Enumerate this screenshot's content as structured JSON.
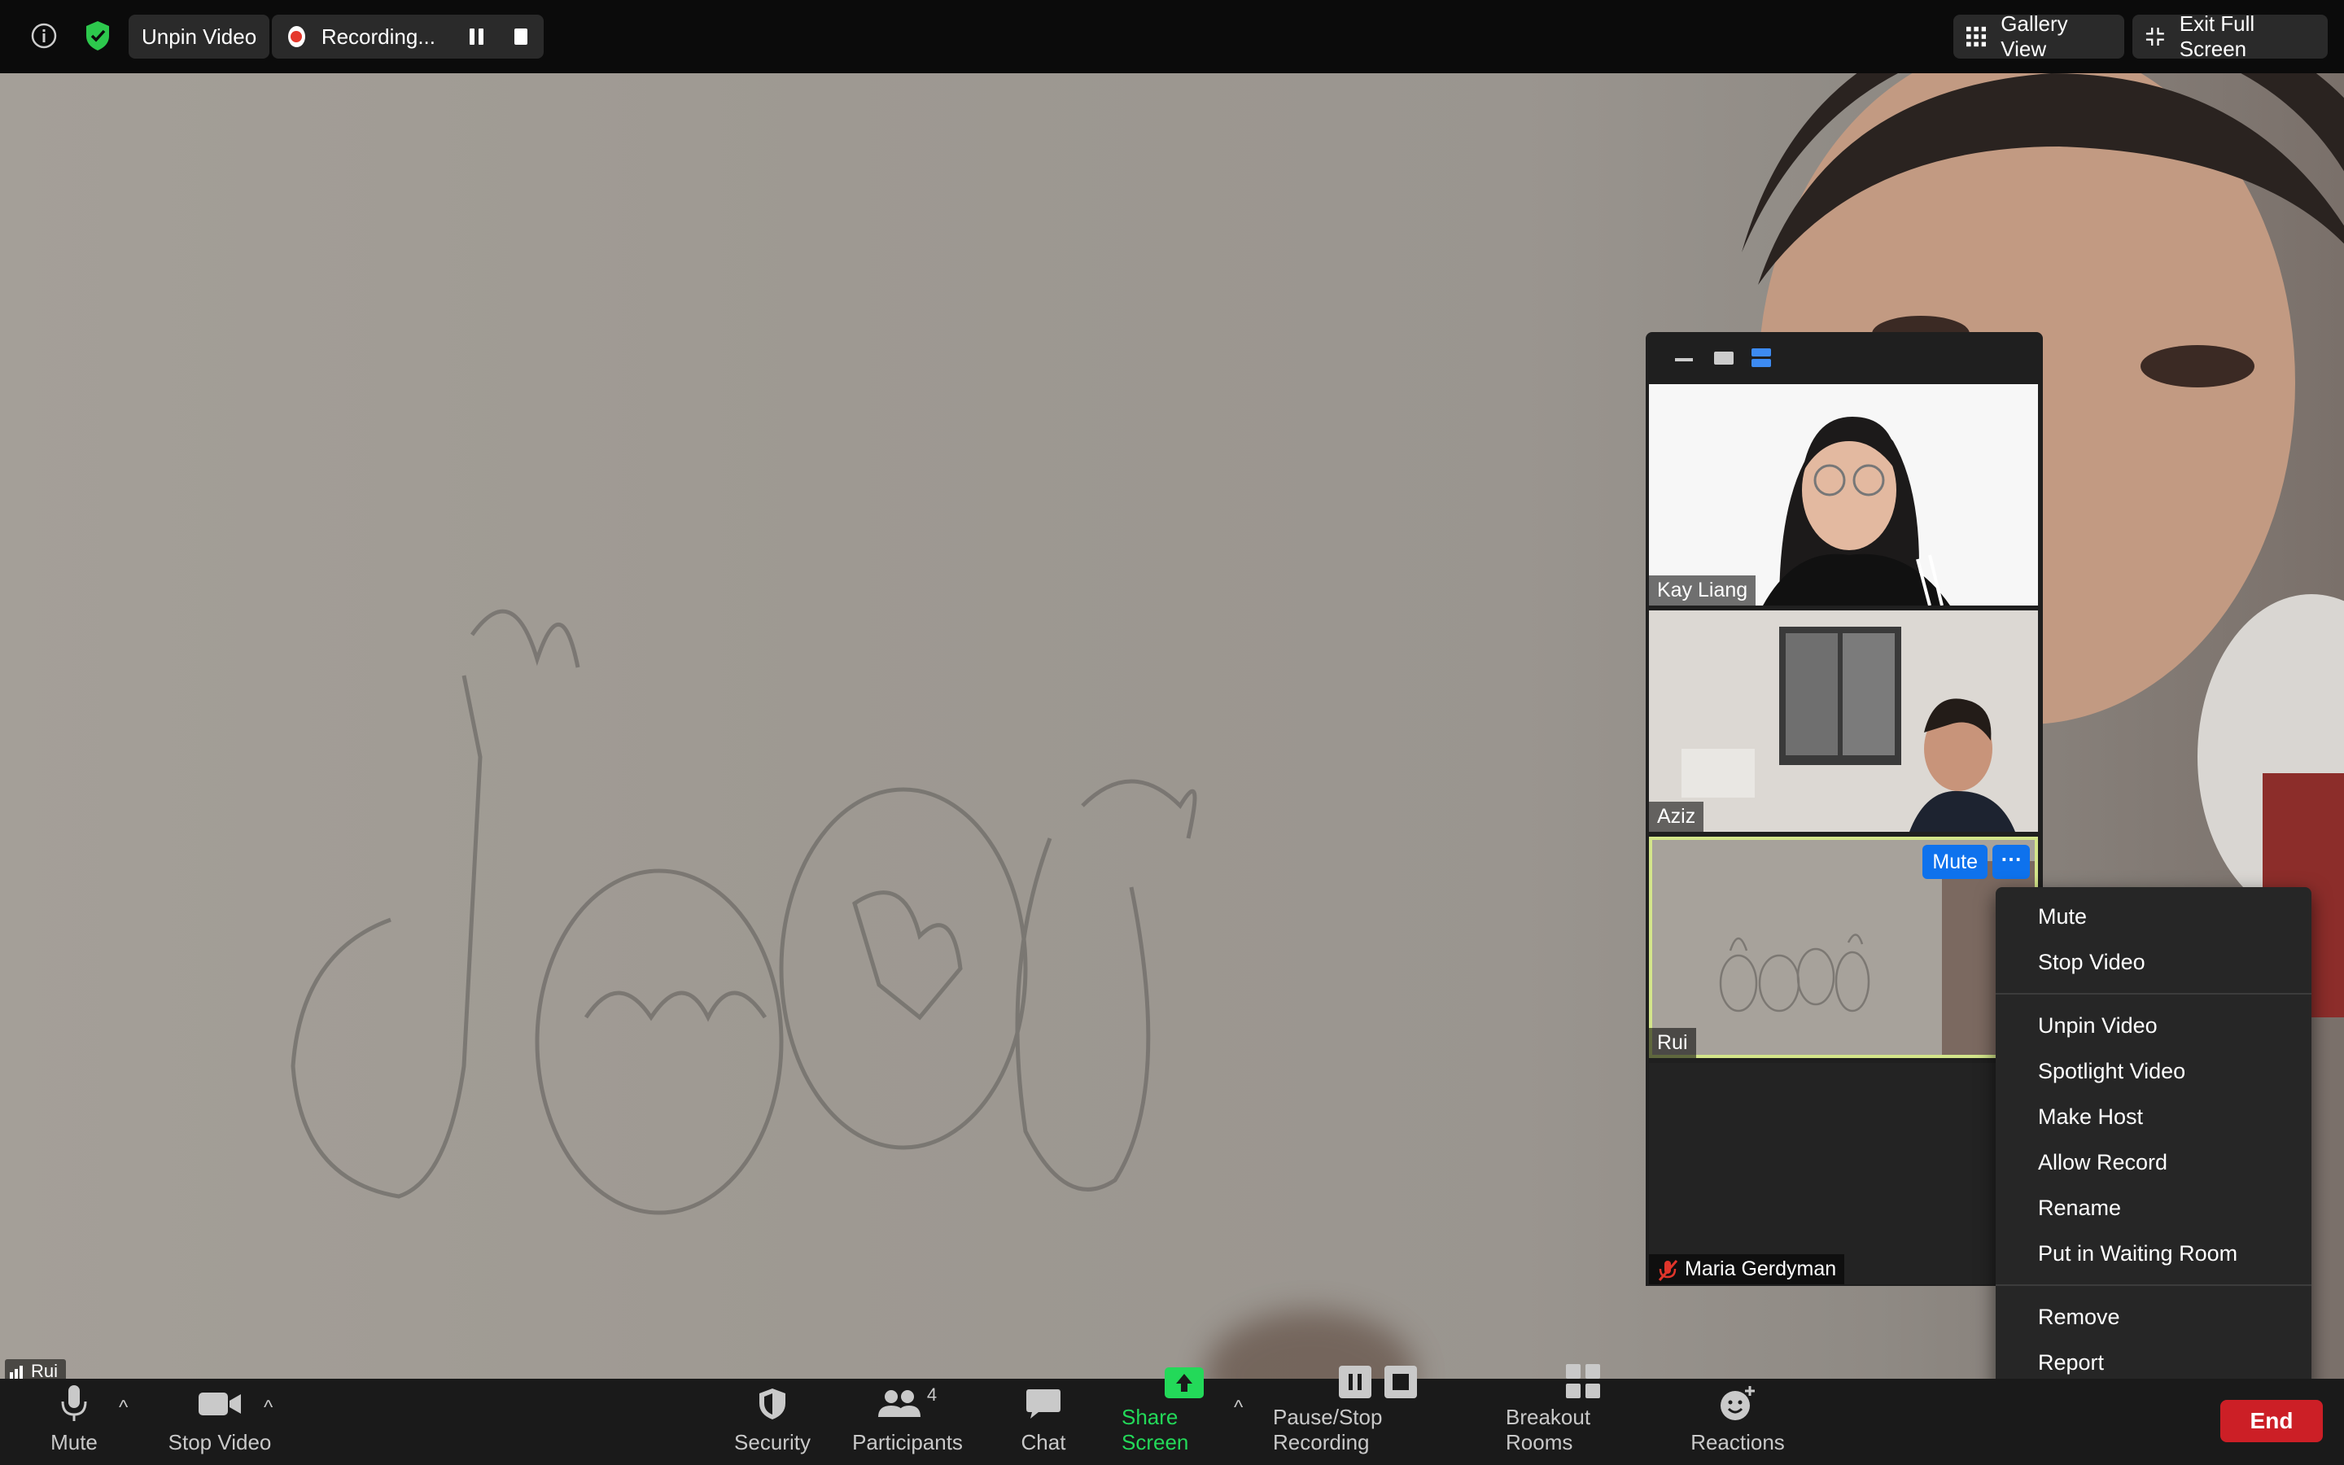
{
  "top_bar": {
    "unpin_label": "Unpin Video",
    "recording_label": "Recording...",
    "gallery_view_label": "Gallery View",
    "exit_full_screen_label": "Exit Full Screen"
  },
  "main_video": {
    "speaker_name": "Rui"
  },
  "panel": {
    "participants": [
      {
        "name": "Kay Liang"
      },
      {
        "name": "Aziz"
      },
      {
        "name": "Rui"
      },
      {
        "name": "Maria Gerdyman",
        "muted": true
      }
    ],
    "mute_button_label": "Mute",
    "more_button_label": "⋯"
  },
  "context_menu": {
    "items": [
      "Mute",
      "Stop Video",
      "Unpin Video",
      "Spotlight Video",
      "Make Host",
      "Allow Record",
      "Rename",
      "Put in Waiting Room",
      "Remove",
      "Report"
    ]
  },
  "toolbar": {
    "mute_label": "Mute",
    "stop_video_label": "Stop Video",
    "security_label": "Security",
    "participants_label": "Participants",
    "participants_count": "4",
    "chat_label": "Chat",
    "share_screen_label": "Share Screen",
    "pause_stop_recording_label": "Pause/Stop Recording",
    "breakout_rooms_label": "Breakout Rooms",
    "reactions_label": "Reactions",
    "end_label": "End"
  },
  "colors": {
    "accent_blue": "#0e72ed",
    "share_green": "#23d959",
    "end_red": "#cc1f26",
    "active_border": "#d3e58a",
    "recording_red": "#e5382c"
  }
}
